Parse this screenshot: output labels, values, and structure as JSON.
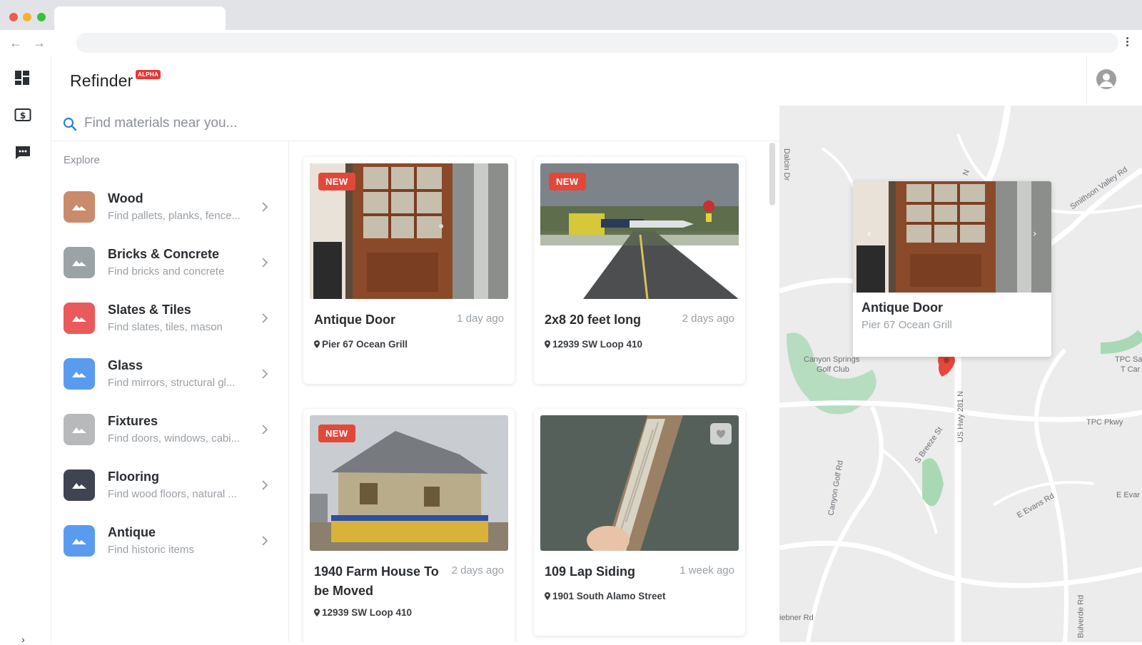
{
  "app": {
    "name": "Refinder",
    "badge": "ALPHA"
  },
  "search": {
    "placeholder": "Find materials near you..."
  },
  "explore": {
    "label": "Explore",
    "categories": [
      {
        "title": "Wood",
        "subtitle": "Find pallets, planks, fence...",
        "color": "#c98b6b"
      },
      {
        "title": "Bricks & Concrete",
        "subtitle": "Find bricks and concrete",
        "color": "#9aa3a6"
      },
      {
        "title": "Slates & Tiles",
        "subtitle": "Find slates, tiles, mason",
        "color": "#ea5a5a"
      },
      {
        "title": "Glass",
        "subtitle": "Find mirrors, structural gl...",
        "color": "#5a9bf0"
      },
      {
        "title": "Fixtures",
        "subtitle": "Find doors, windows, cabi...",
        "color": "#b8b9bb"
      },
      {
        "title": "Flooring",
        "subtitle": "Find wood floors, natural ...",
        "color": "#3e4451"
      },
      {
        "title": "Antique",
        "subtitle": "Find historic items",
        "color": "#5a9bf0"
      }
    ]
  },
  "listings": [
    {
      "title": "Antique Door",
      "time": "1 day ago",
      "location": "Pier 67 Ocean Grill",
      "badge": "NEW"
    },
    {
      "title": "2x8 20 feet long",
      "time": "2 days ago",
      "location": "12939 SW Loop 410",
      "badge": "NEW"
    },
    {
      "title": "1940 Farm House To be Moved",
      "time": "2 days ago",
      "location": "12939 SW Loop 410",
      "badge": "NEW"
    },
    {
      "title": "109 Lap Siding",
      "time": "1 week ago",
      "location": "1901 South Alamo Street",
      "badge": ""
    }
  ],
  "map": {
    "popup": {
      "title": "Antique Door",
      "subtitle": "Pier 67 Ocean Grill"
    },
    "labels": [
      "Dalcin Dr",
      "Smithson Valley Rd",
      "Canyon Springs",
      "Golf Club",
      "TPC Sa",
      "T Car",
      "TPC Pkwy",
      "Canyon Golf Rd",
      "S Breeze St",
      "US Hwy 281 N",
      "E Evans Rd",
      "E Evar",
      "Bulverde Rd",
      "iebner Rd",
      "N"
    ]
  },
  "icons": {
    "rail": [
      "dashboard-icon",
      "billing-icon",
      "messages-icon"
    ],
    "accent": "#2f80ed",
    "new_badge": "#e2483a"
  }
}
